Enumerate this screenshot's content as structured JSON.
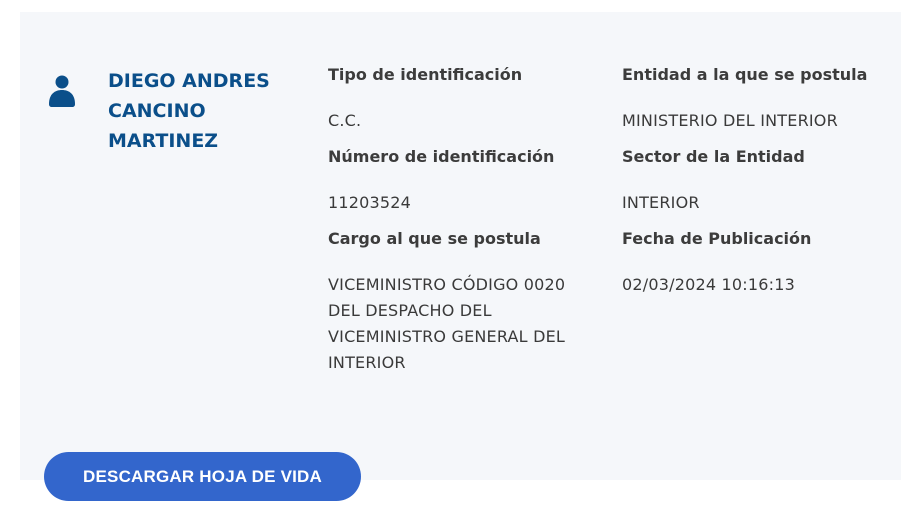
{
  "person": {
    "name": "DIEGO ANDRES CANCINO MARTINEZ",
    "icon": "user-icon"
  },
  "fields": {
    "tipo_id_label": "Tipo de identificación",
    "tipo_id_value": "C.C.",
    "numero_id_label": "Número de identificación",
    "numero_id_value": "11203524",
    "cargo_label": "Cargo al que se postula",
    "cargo_value": "VICEMINISTRO CÓDIGO 0020 DEL DESPACHO DEL VICEMINISTRO GENERAL DEL INTERIOR",
    "entidad_label": "Entidad a la que se postula",
    "entidad_value": "MINISTERIO DEL INTERIOR",
    "sector_label": "Sector de la Entidad",
    "sector_value": "INTERIOR",
    "fecha_label": "Fecha de Publicación",
    "fecha_value": "02/03/2024 10:16:13"
  },
  "actions": {
    "download_label": "DESCARGAR HOJA DE VIDA"
  },
  "colors": {
    "name": "#0b4f8a",
    "button": "#3366cc",
    "card_bg": "#f5f7fa"
  }
}
